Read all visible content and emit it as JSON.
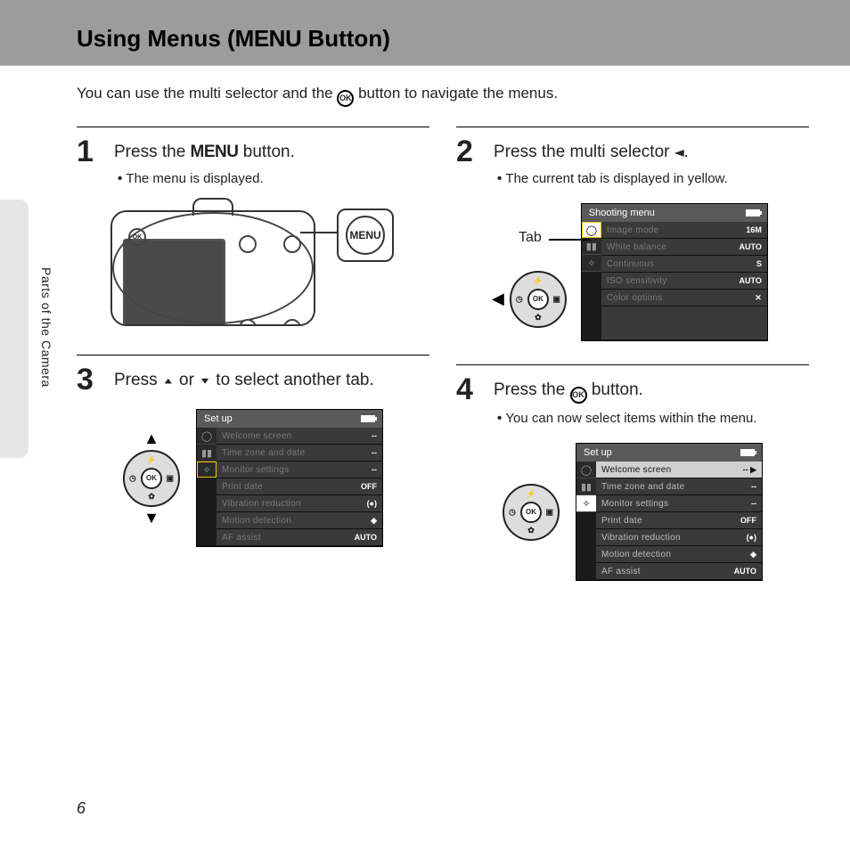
{
  "header": {
    "title_prefix": "Using Menus (",
    "title_menu": "MENU",
    "title_suffix": " Button)"
  },
  "intro": {
    "text_before": "You can use the multi selector and the ",
    "ok_label": "OK",
    "text_after": " button to navigate the menus."
  },
  "sidebar": {
    "section_label": "Parts of the Camera"
  },
  "page_number": "6",
  "step1": {
    "num": "1",
    "title_before": "Press the ",
    "title_menu": "MENU",
    "title_after": " button.",
    "bullet": "The menu is displayed.",
    "callout_menu_label": "MENU",
    "dpad_ok": "OK"
  },
  "step2": {
    "num": "2",
    "tri_left": "◀",
    "title_before": "Press the multi selector ",
    "title_after": ".",
    "bullet": "The current tab is displayed in yellow.",
    "tab_callout": "Tab",
    "selector_ok": "OK",
    "lcd": {
      "title": "Shooting menu",
      "tabs": [
        "◯",
        "▮▮",
        "✧"
      ],
      "items": [
        {
          "label": "Image mode",
          "val": "16M"
        },
        {
          "label": "White balance",
          "val": "AUTO"
        },
        {
          "label": "Continuous",
          "val": "S"
        },
        {
          "label": "ISO sensitivity",
          "val": "AUTO"
        },
        {
          "label": "Color options",
          "val": "✕"
        }
      ]
    }
  },
  "step3": {
    "num": "3",
    "tri_up": "▲",
    "tri_down": "▼",
    "title_before": "Press ",
    "title_mid": " or ",
    "title_after": " to select another tab.",
    "selector_ok": "OK",
    "lcd": {
      "title": "Set up",
      "tabs": [
        "◯",
        "▮▮",
        "✧"
      ],
      "items": [
        {
          "label": "Welcome screen",
          "val": "--"
        },
        {
          "label": "Time zone and date",
          "val": "--"
        },
        {
          "label": "Monitor settings",
          "val": "--"
        },
        {
          "label": "Print date",
          "val": "OFF"
        },
        {
          "label": "Vibration reduction",
          "val": "(●)"
        },
        {
          "label": "Motion detection",
          "val": "◈"
        },
        {
          "label": "AF assist",
          "val": "AUTO"
        }
      ]
    }
  },
  "step4": {
    "num": "4",
    "title_before": "Press the ",
    "ok_label": "OK",
    "title_after": " button.",
    "bullet": "You can now select items within the menu.",
    "selector_ok": "OK",
    "lcd": {
      "title": "Set up",
      "tabs": [
        "◯",
        "▮▮",
        "✧"
      ],
      "items": [
        {
          "label": "Welcome screen",
          "val": "--",
          "sel": true
        },
        {
          "label": "Time zone and date",
          "val": "--"
        },
        {
          "label": "Monitor settings",
          "val": "--"
        },
        {
          "label": "Print date",
          "val": "OFF"
        },
        {
          "label": "Vibration reduction",
          "val": "(●)"
        },
        {
          "label": "Motion detection",
          "val": "◈"
        },
        {
          "label": "AF assist",
          "val": "AUTO"
        }
      ]
    }
  }
}
